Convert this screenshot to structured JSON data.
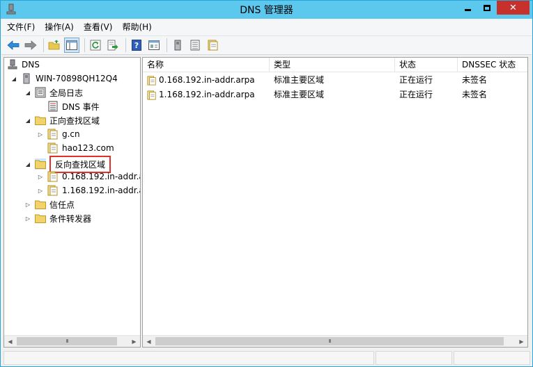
{
  "window": {
    "title": "DNS 管理器",
    "close_glyph": "✕"
  },
  "menu": [
    {
      "label": "文件(F)"
    },
    {
      "label": "操作(A)"
    },
    {
      "label": "查看(V)"
    },
    {
      "label": "帮助(H)"
    }
  ],
  "toolbar": {
    "icons": [
      "back-icon",
      "forward-icon",
      "up-folder-icon",
      "show-hide-tree-icon",
      "refresh-icon",
      "export-list-icon",
      "help-icon",
      "view-icon",
      "server-icon",
      "list-icon",
      "zone-icon"
    ]
  },
  "tree": {
    "root": "DNS",
    "server": "WIN-70898QH12Q4",
    "global_logs": "全局日志",
    "dns_events": "DNS 事件",
    "forward_zones": "正向查找区域",
    "forward_items": [
      "g.cn",
      "hao123.com"
    ],
    "reverse_zones": "反向查找区域",
    "reverse_items": [
      "0.168.192.in-addr.a",
      "1.168.192.in-addr.a"
    ],
    "trust_points": "信任点",
    "conditional_forwarders": "条件转发器"
  },
  "list": {
    "columns": [
      "名称",
      "类型",
      "状态",
      "DNSSEC 状态"
    ],
    "rows": [
      {
        "name": "0.168.192.in-addr.arpa",
        "type": "标准主要区域",
        "status": "正在运行",
        "dnssec": "未签名"
      },
      {
        "name": "1.168.192.in-addr.arpa",
        "type": "标准主要区域",
        "status": "正在运行",
        "dnssec": "未签名"
      }
    ]
  },
  "colors": {
    "titlebar": "#5cc8ee",
    "close_button": "#c7312c",
    "selection_outline": "#e0302c"
  }
}
